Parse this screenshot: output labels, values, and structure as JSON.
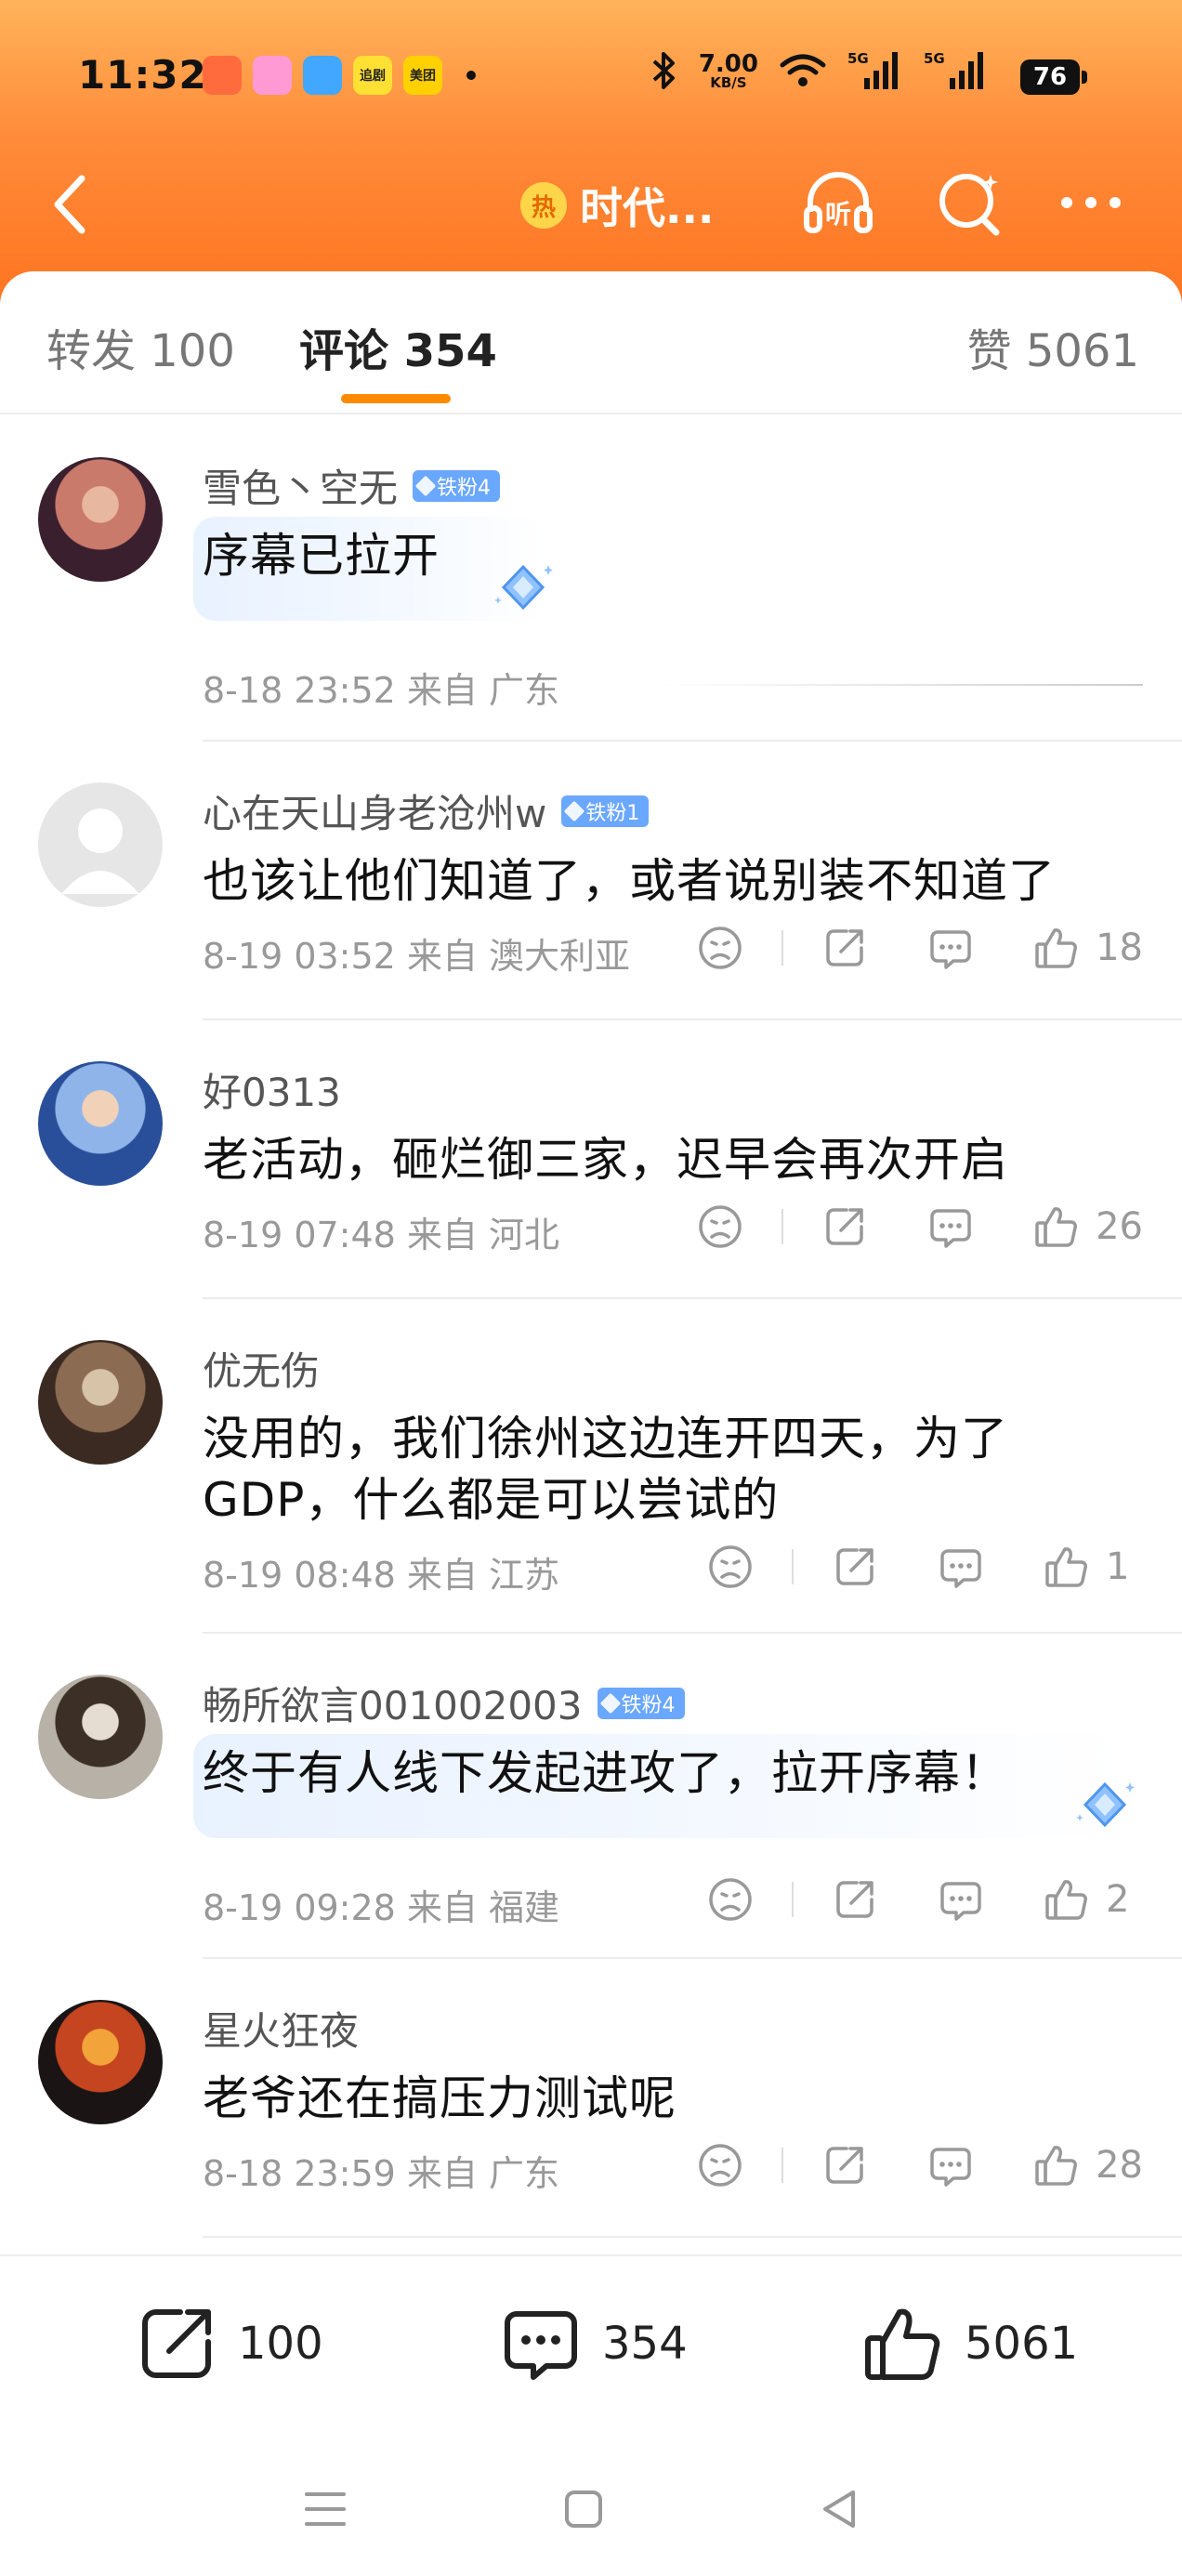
{
  "status_bar": {
    "time": "11:32",
    "app_icons": [
      {
        "name": "app-icon-1",
        "label": "",
        "color": "#ff6b3d"
      },
      {
        "name": "app-icon-2",
        "label": "",
        "color": "#ff9ad5"
      },
      {
        "name": "app-icon-3",
        "label": "",
        "color": "#41a7ff"
      },
      {
        "name": "app-icon-4",
        "label": "追剧",
        "color": "#ffe033"
      },
      {
        "name": "app-icon-5",
        "label": "美团",
        "color": "#ffd100"
      }
    ],
    "net_speed": "7.00",
    "net_unit": "KB/S",
    "signal1_label": "5G",
    "signal2_label": "5G",
    "battery": "76"
  },
  "nav": {
    "hot_badge": "热",
    "title": "时代...",
    "listen_label": "听"
  },
  "tabs": [
    {
      "label": "转发 100"
    },
    {
      "label": "评论 354"
    },
    {
      "label": "赞 5061"
    }
  ],
  "comments": [
    {
      "username": "雪色丶空无",
      "fan_badge": "铁粉4",
      "text": [
        "序幕已拉开"
      ],
      "time": "8-18 23:52",
      "location": "来自 广东",
      "likes": "",
      "highlight": true,
      "avatar_colors": [
        "#3a1f2e",
        "#c97a6a",
        "#e8b7a0"
      ]
    },
    {
      "username": "心在天山身老沧州w",
      "fan_badge": "铁粉1",
      "text": [
        "也该让他们知道了，或者说别装不知道了"
      ],
      "time": "8-19 03:52",
      "location": "来自 澳大利亚",
      "likes": "18",
      "highlight": false,
      "avatar_colors": [
        "#e6e6e6",
        "#ffffff",
        "#d0d0d0"
      ]
    },
    {
      "username": "好0313",
      "fan_badge": "",
      "text": [
        "老活动，砸烂御三家，迟早会再次开启"
      ],
      "time": "8-19 07:48",
      "location": "来自 河北",
      "likes": "26",
      "highlight": false,
      "avatar_colors": [
        "#2a4f9a",
        "#8fb4ea",
        "#f1d2b8"
      ]
    },
    {
      "username": "优无伤",
      "fan_badge": "",
      "text": [
        "没用的，我们徐州这边连开四天，为了",
        "GDP，什么都是可以尝试的"
      ],
      "time": "8-19 08:48",
      "location": "来自 江苏",
      "likes": "1",
      "highlight": false,
      "avatar_colors": [
        "#3b2a22",
        "#8b6b52",
        "#d7c3a8"
      ]
    },
    {
      "username": "畅所欲言001002003",
      "fan_badge": "铁粉4",
      "text": [
        "终于有人线下发起进攻了，拉开序幕！"
      ],
      "time": "8-19 09:28",
      "location": "来自 福建",
      "likes": "2",
      "highlight": true,
      "avatar_colors": [
        "#b7b1a8",
        "#3c2f25",
        "#e5ddd2"
      ]
    },
    {
      "username": "星火狂夜",
      "fan_badge": "",
      "text": [
        "老爷还在搞压力测试呢"
      ],
      "time": "8-18 23:59",
      "location": "来自 广东",
      "likes": "28",
      "highlight": false,
      "avatar_colors": [
        "#1a1414",
        "#c4451f",
        "#f2a33a"
      ]
    }
  ],
  "bottom_bar": {
    "repost_count": "100",
    "comment_count": "354",
    "like_count": "5061"
  },
  "colors": {
    "accent": "#ff8a00",
    "header_top": "#ffb35a",
    "header_bottom": "#ff7420",
    "fan_badge": "#6aa7ff"
  },
  "icons": {
    "back": "back-arrow-icon",
    "listen": "headphones-icon",
    "search": "search-icon",
    "more": "more-icon",
    "dislike": "dislike-face-icon",
    "share": "share-icon",
    "reply": "comment-icon",
    "like": "thumbs-up-icon"
  }
}
